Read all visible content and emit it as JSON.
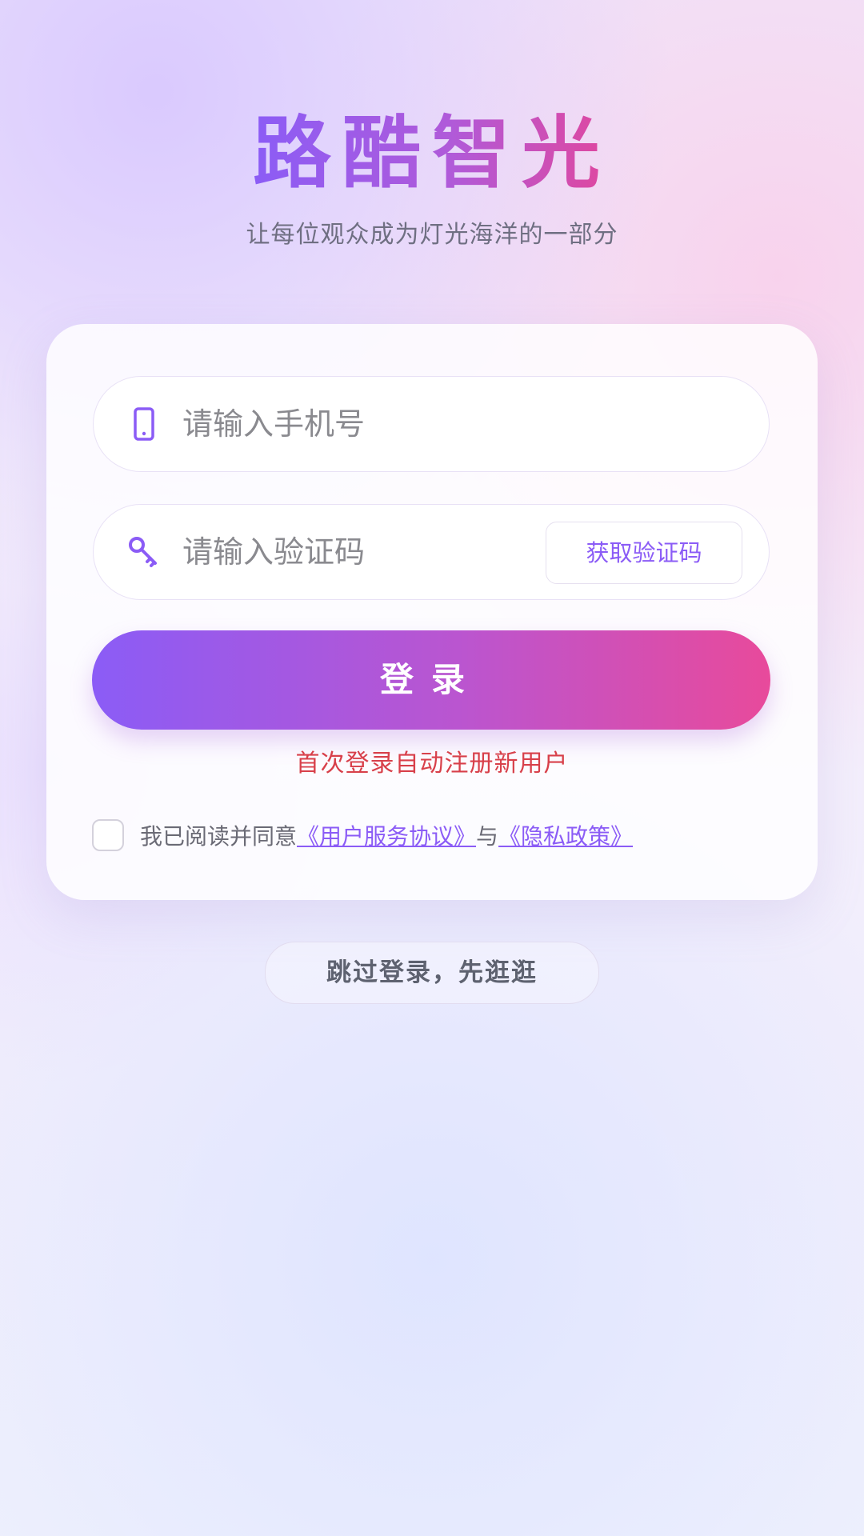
{
  "brand": {
    "title": "路酷智光",
    "subtitle": "让每位观众成为灯光海洋的一部分"
  },
  "login_form": {
    "phone_field": {
      "icon": "phone-icon",
      "placeholder": "请输入手机号",
      "value": ""
    },
    "code_field": {
      "icon": "key-icon",
      "placeholder": "请输入验证码",
      "value": ""
    },
    "get_code_label": "获取验证码",
    "login_label": "登录",
    "auto_register_note": "首次登录自动注册新用户",
    "agreement": {
      "checked": false,
      "prefix": "我已阅读并同意",
      "terms_link": "《用户服务协议》",
      "conjunction": "与",
      "privacy_link": "《隐私政策》"
    }
  },
  "skip_label": "跳过登录，先逛逛",
  "colors": {
    "accent_start": "#8b5cf6",
    "accent_end": "#e84a9b",
    "warning_text": "#d8404a",
    "link": "#8b5cf6"
  }
}
